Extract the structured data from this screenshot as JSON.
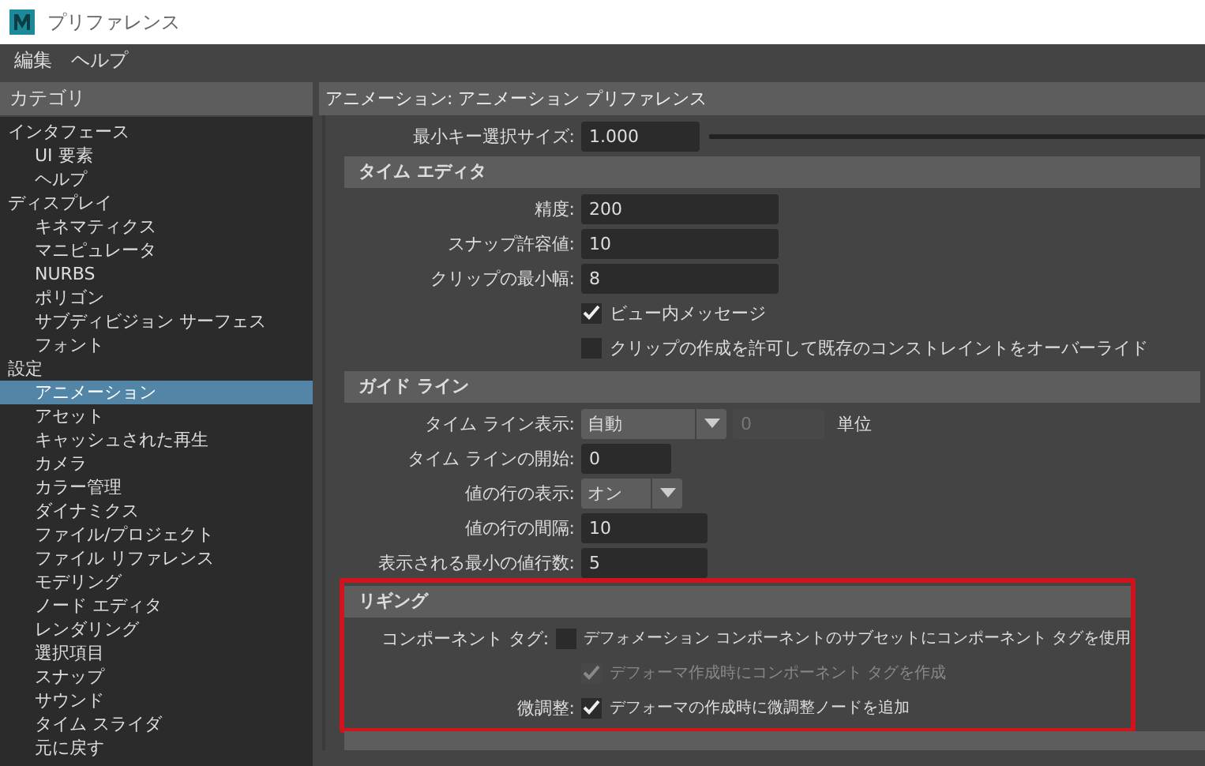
{
  "window": {
    "title": "プリファレンス"
  },
  "menu": [
    "編集",
    "ヘルプ"
  ],
  "categories": {
    "title": "カテゴリ",
    "items": [
      {
        "label": "インタフェース",
        "selected": false,
        "children": [
          {
            "label": "UI 要素",
            "selected": false
          },
          {
            "label": "ヘルプ",
            "selected": false
          }
        ]
      },
      {
        "label": "ディスプレイ",
        "selected": false,
        "children": [
          {
            "label": "キネマティクス",
            "selected": false
          },
          {
            "label": "マニピュレータ",
            "selected": false
          },
          {
            "label": "NURBS",
            "selected": false
          },
          {
            "label": "ポリゴン",
            "selected": false
          },
          {
            "label": "サブディビジョン サーフェス",
            "selected": false
          },
          {
            "label": "フォント",
            "selected": false
          }
        ]
      },
      {
        "label": "設定",
        "selected": false,
        "children": [
          {
            "label": "アニメーション",
            "selected": true
          },
          {
            "label": "アセット",
            "selected": false
          },
          {
            "label": "キャッシュされた再生",
            "selected": false
          },
          {
            "label": "カメラ",
            "selected": false
          },
          {
            "label": "カラー管理",
            "selected": false
          },
          {
            "label": "ダイナミクス",
            "selected": false
          },
          {
            "label": "ファイル/プロジェクト",
            "selected": false
          },
          {
            "label": "ファイル リファレンス",
            "selected": false
          },
          {
            "label": "モデリング",
            "selected": false
          },
          {
            "label": "ノード エディタ",
            "selected": false
          },
          {
            "label": "レンダリング",
            "selected": false
          },
          {
            "label": "選択項目",
            "selected": false
          },
          {
            "label": "スナップ",
            "selected": false
          },
          {
            "label": "サウンド",
            "selected": false
          },
          {
            "label": "タイム スライダ",
            "selected": false
          },
          {
            "label": "元に戻す",
            "selected": false
          }
        ]
      }
    ]
  },
  "panel": {
    "title": "アニメーション: アニメーション プリファレンス",
    "top_rows": [
      {
        "kind": "slider",
        "label": "最小キー選択サイズ:",
        "value": "1.000"
      }
    ],
    "sections": [
      {
        "title": "タイム エディタ",
        "rows": [
          {
            "kind": "field",
            "label": "精度:",
            "value": "200"
          },
          {
            "kind": "field",
            "label": "スナップ許容値:",
            "value": "10"
          },
          {
            "kind": "field",
            "label": "クリップの最小幅:",
            "value": "8"
          },
          {
            "kind": "checkbox",
            "text": "ビュー内メッセージ",
            "checked": true,
            "disabled": false
          },
          {
            "kind": "checkbox",
            "text": "クリップの作成を許可して既存のコンストレイントをオーバーライド",
            "checked": false,
            "disabled": false
          }
        ]
      },
      {
        "title": "ガイド ライン",
        "rows": [
          {
            "kind": "dropdown",
            "label": "タイム ライン表示:",
            "value": "自動",
            "extra_value": "0",
            "extra_disabled": true,
            "unit": "単位"
          },
          {
            "kind": "field",
            "label": "タイム ラインの開始:",
            "value": "0"
          },
          {
            "kind": "dropdown",
            "label": "値の行の表示:",
            "value": "オン"
          },
          {
            "kind": "field",
            "label": "値の行の間隔:",
            "value": "10"
          },
          {
            "kind": "field",
            "label": "表示される最小の値行数:",
            "value": "5"
          }
        ]
      },
      {
        "title": "リギング",
        "highlighted": true,
        "rows": [
          {
            "kind": "checkbox",
            "label": "コンポーネント タグ:",
            "text": "デフォメーション コンポーネントのサブセットにコンポーネント タグを使用",
            "checked": false,
            "disabled": false
          },
          {
            "kind": "checkbox",
            "text": "デフォーマ作成時にコンポーネント タグを作成",
            "checked": true,
            "disabled": true
          },
          {
            "kind": "checkbox",
            "label": "微調整:",
            "text": "デフォーマの作成時に微調整ノードを追加",
            "checked": true,
            "disabled": false
          }
        ]
      }
    ]
  }
}
